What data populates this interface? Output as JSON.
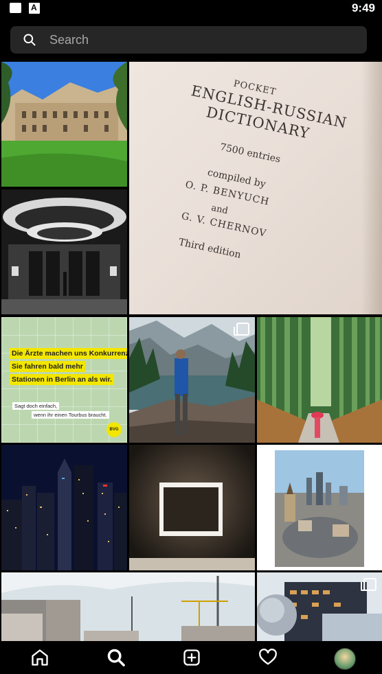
{
  "status_bar": {
    "time": "9:49"
  },
  "search": {
    "placeholder": "Search"
  },
  "dictionary": {
    "lines": [
      "POCKET",
      "ENGLISH-RUSSIAN",
      "DICTIONARY",
      "7500 entries",
      "compiled by",
      "O. P. BENYUCH",
      "and",
      "G. V. CHERNOV",
      "Third edition"
    ]
  },
  "poster": {
    "headline_lines": [
      "Die Ärzte machen uns Konkurrenz:",
      "Sie fahren bald mehr",
      "Stationen in Berlin an als wir."
    ],
    "sub_lines": [
      "Sagt doch einfach,",
      "wenn ihr einen Tourbus braucht."
    ],
    "logo": "BVG"
  },
  "nav": {
    "items": [
      "home-icon",
      "search-icon",
      "create-icon",
      "activity-icon",
      "profile-avatar"
    ]
  }
}
